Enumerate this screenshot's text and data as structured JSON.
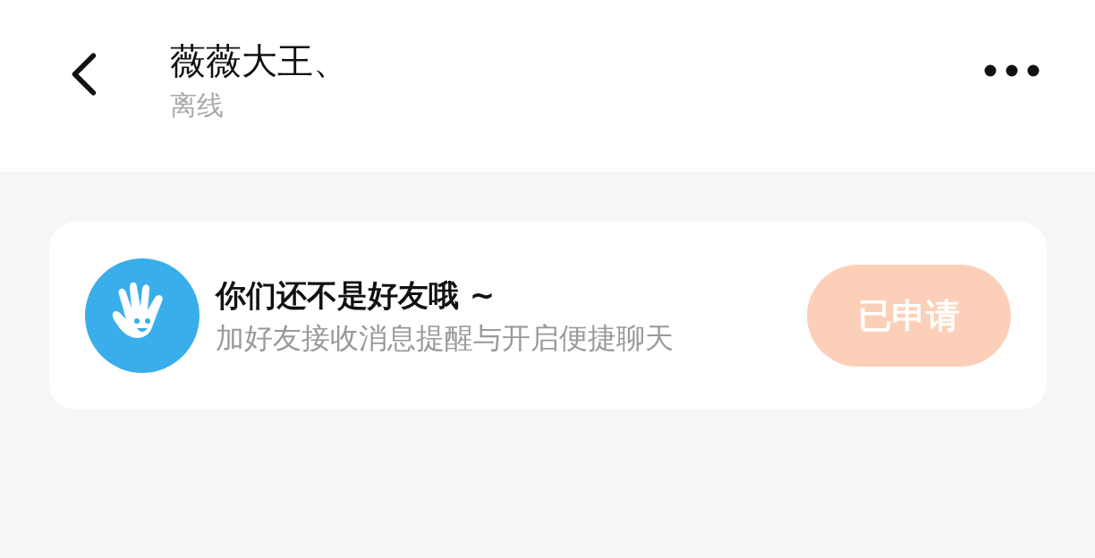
{
  "header": {
    "title": "薇薇大王、",
    "status": "离线"
  },
  "notice": {
    "title": "你们还不是好友哦 ~",
    "message": "加好友接收消息提醒与开启便捷聊天",
    "button": {
      "label": "已申请",
      "disabled": true
    }
  }
}
